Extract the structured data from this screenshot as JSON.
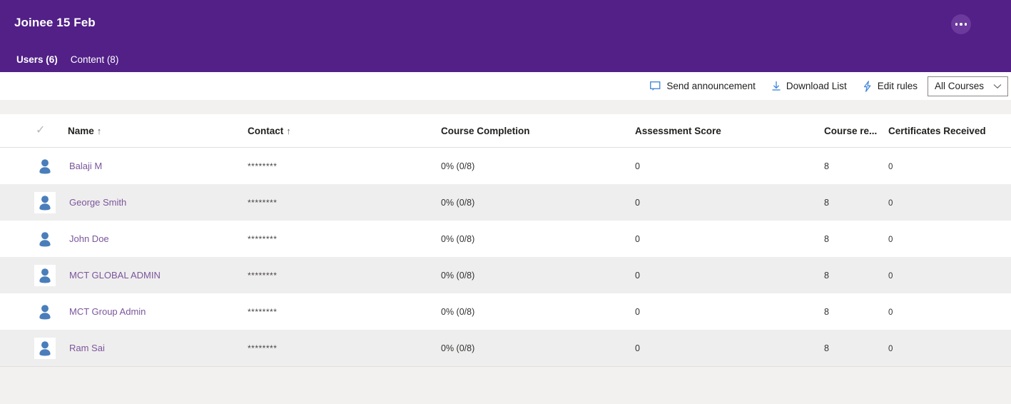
{
  "header": {
    "title": "Joinee 15 Feb",
    "overflow_label": "...",
    "background_color": "#522087",
    "tabs": [
      {
        "label": "Users (6)",
        "active": true
      },
      {
        "label": "Content (8)",
        "active": false
      }
    ]
  },
  "toolbar": {
    "actions": [
      {
        "icon": "comment-icon",
        "label": "Send announcement"
      },
      {
        "icon": "download-icon",
        "label": "Download List"
      },
      {
        "icon": "lightning-icon",
        "label": "Edit rules"
      }
    ],
    "course_filter": {
      "selected": "All Courses",
      "options": [
        "All Courses"
      ]
    }
  },
  "table": {
    "select_all_glyph": "✓",
    "columns": [
      {
        "key": "name",
        "label": "Name",
        "sort": "↑"
      },
      {
        "key": "contact",
        "label": "Contact",
        "sort": "↑"
      },
      {
        "key": "completion",
        "label": "Course Completion",
        "sort": ""
      },
      {
        "key": "assessment",
        "label": "Assessment Score",
        "sort": ""
      },
      {
        "key": "registered",
        "label": "Course re...",
        "sort": ""
      },
      {
        "key": "certificates",
        "label": "Certificates Received",
        "sort": ""
      }
    ],
    "rows": [
      {
        "name": "Balaji M",
        "contact": "********",
        "completion": "0% (0/8)",
        "assessment": "0",
        "registered": "8",
        "certificates": "0"
      },
      {
        "name": "George Smith",
        "contact": "********",
        "completion": "0% (0/8)",
        "assessment": "0",
        "registered": "8",
        "certificates": "0"
      },
      {
        "name": "John Doe",
        "contact": "********",
        "completion": "0% (0/8)",
        "assessment": "0",
        "registered": "8",
        "certificates": "0"
      },
      {
        "name": "MCT GLOBAL ADMIN",
        "contact": "********",
        "completion": "0% (0/8)",
        "assessment": "0",
        "registered": "8",
        "certificates": "0"
      },
      {
        "name": "MCT Group Admin",
        "contact": "********",
        "completion": "0% (0/8)",
        "assessment": "0",
        "registered": "8",
        "certificates": "0"
      },
      {
        "name": "Ram Sai",
        "contact": "********",
        "completion": "0% (0/8)",
        "assessment": "0",
        "registered": "8",
        "certificates": "0"
      }
    ]
  },
  "colors": {
    "brand_purple": "#522087",
    "link_purple": "#7a569c",
    "accent_blue": "#0078d4",
    "avatar_blue": "#4a7ebb",
    "row_alt": "#efeeee",
    "page_bg": "#f2f1f0"
  }
}
